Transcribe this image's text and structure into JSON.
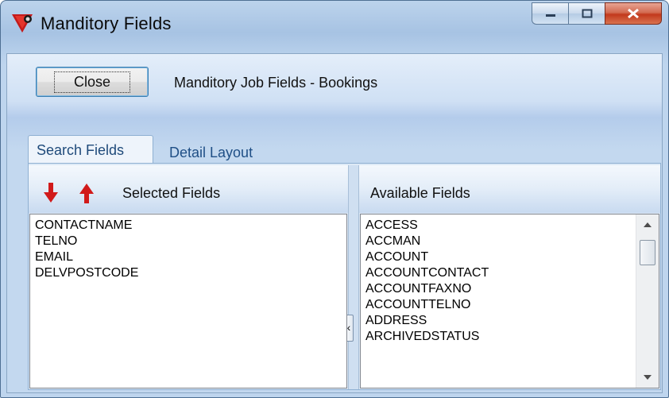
{
  "window": {
    "title": "Manditory Fields"
  },
  "header": {
    "close_label": "Close",
    "description": "Manditory Job Fields - Bookings"
  },
  "tabs": [
    {
      "label": "Search Fields",
      "active": true
    },
    {
      "label": "Detail Layout",
      "active": false
    }
  ],
  "selected_panel": {
    "title": "Selected Fields",
    "items": [
      "CONTACTNAME",
      "TELNO",
      "EMAIL",
      "DELVPOSTCODE"
    ]
  },
  "available_panel": {
    "title": "Available Fields",
    "items": [
      "ACCESS",
      "ACCMAN",
      "ACCOUNT",
      "ACCOUNTCONTACT",
      "ACCOUNTFAXNO",
      "ACCOUNTTELNO",
      "ADDRESS",
      "ARCHIVEDSTATUS"
    ]
  },
  "splitter": {
    "move_left_glyph": "‹"
  },
  "icons": {
    "app": "app-icon",
    "move_down": "arrow-down-icon",
    "move_up": "arrow-up-icon"
  },
  "colors": {
    "arrow_red": "#d11a1a",
    "close_red": "#c2391c"
  }
}
